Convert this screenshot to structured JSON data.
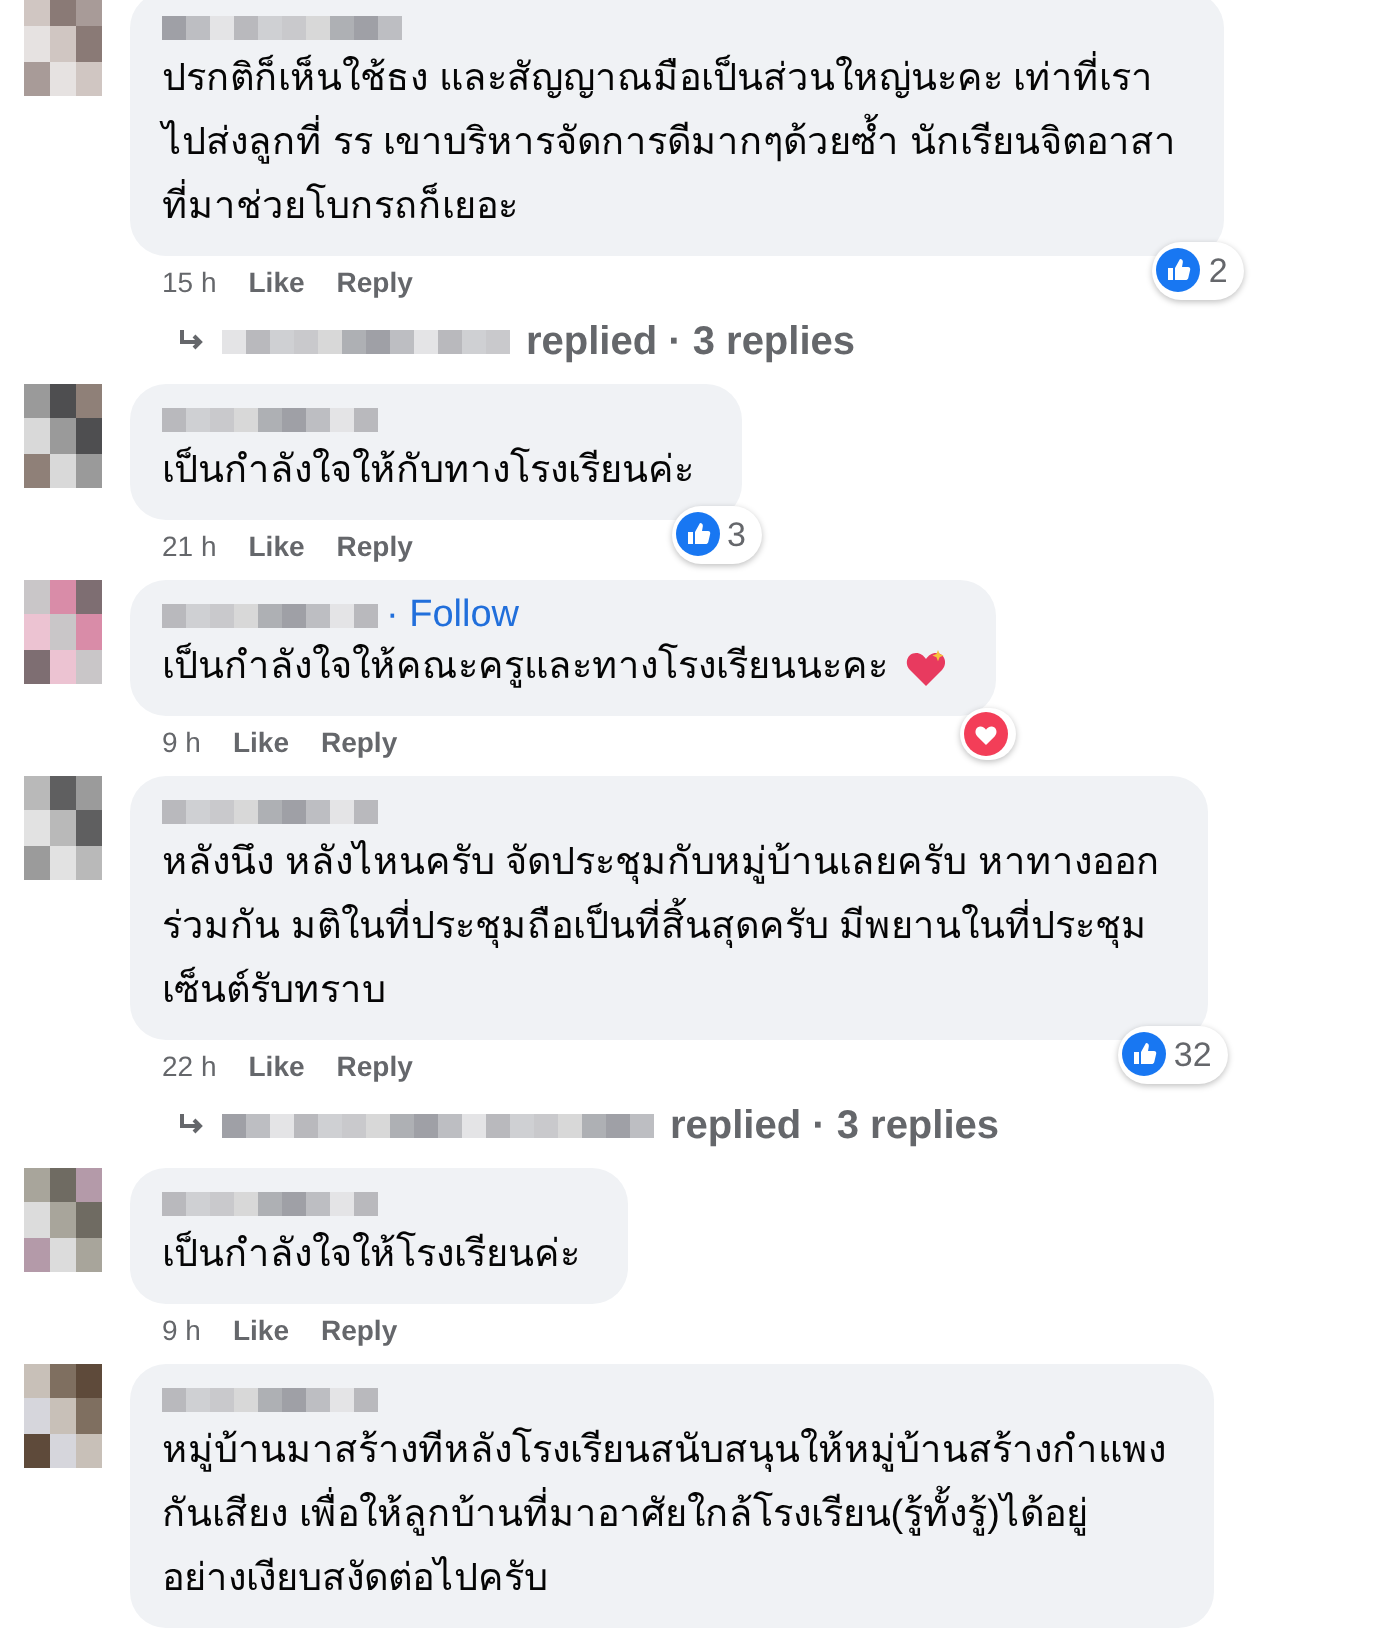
{
  "comments": [
    {
      "lines": [
        "ปรกติก็เห็นใช้ธง และสัญญาณมือเป็นส่วนใหญ่นะคะ เท่าที่เรา",
        "ไปส่งลูกที่ รร เขาบริหารจัดการดีมากๆด้วยซ้ำ นักเรียนจิตอาสา",
        "ที่มาช่วยโบกรถก็เยอะ"
      ],
      "time": "15 h",
      "like": "Like",
      "reply": "Reply",
      "reaction": {
        "kind": "like",
        "count": "2"
      },
      "replies": "replied · 3 replies"
    },
    {
      "lines": [
        "เป็นกำลังใจให้กับทางโรงเรียนค่ะ"
      ],
      "time": "21 h",
      "like": "Like",
      "reply": "Reply",
      "reaction": {
        "kind": "like",
        "count": "3"
      }
    },
    {
      "follow": "· Follow",
      "lines": [
        "เป็นกำลังใจให้คณะครูและทางโรงเรียนนะคะ"
      ],
      "sticker": true,
      "time": "9 h",
      "like": "Like",
      "reply": "Reply",
      "reaction": {
        "kind": "love"
      }
    },
    {
      "lines": [
        "หลังนึง หลังไหนครับ จัดประชุมกับหมู่บ้านเลยครับ หาทางออก",
        "ร่วมกัน มติในที่ประชุมถือเป็นที่สิ้นสุดครับ มีพยานในที่ประชุม",
        "เซ็นต์รับทราบ"
      ],
      "time": "22 h",
      "like": "Like",
      "reply": "Reply",
      "reaction": {
        "kind": "like",
        "count": "32"
      },
      "replies": "replied · 3 replies"
    },
    {
      "lines": [
        "เป็นกำลังใจให้โรงเรียนค่ะ"
      ],
      "time": "9 h",
      "like": "Like",
      "reply": "Reply"
    },
    {
      "lines": [
        "หมู่บ้านมาสร้างทีหลังโรงเรียนสนับสนุนให้หมู่บ้านสร้างกำแพง",
        "กันเสียง เพื่อให้ลูกบ้านที่มาอาศัยใกล้โรงเรียน(รู้ทั้งรู้)ได้อยู่",
        "อย่างเงียบสงัดต่อไปครับ"
      ]
    }
  ]
}
